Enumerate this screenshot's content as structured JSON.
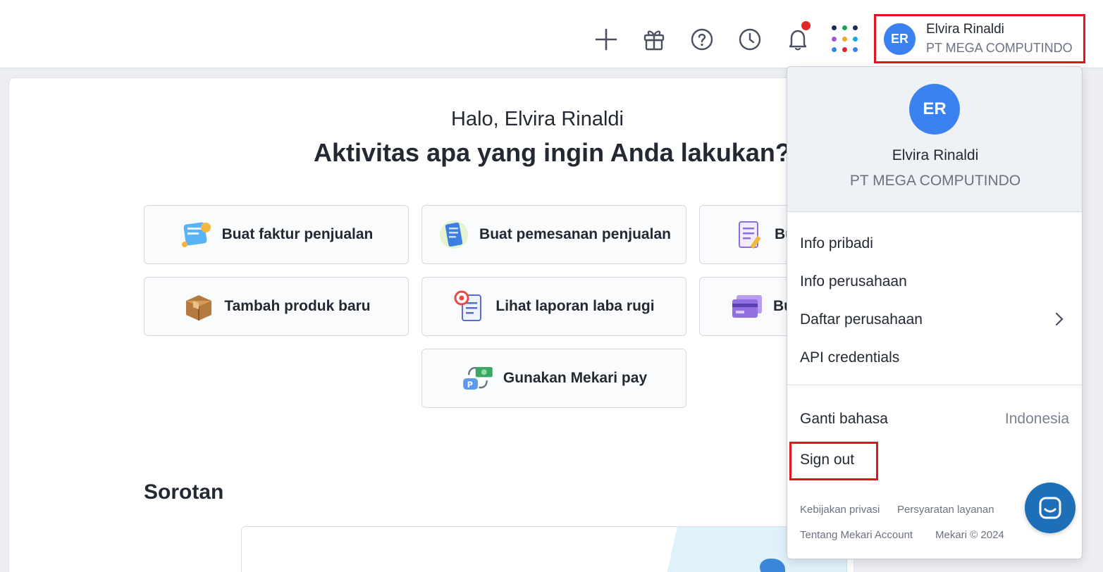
{
  "header": {
    "icons": [
      "plus-icon",
      "gift-icon",
      "help-icon",
      "clock-icon",
      "bell-icon",
      "apps-grid-icon"
    ],
    "notification_dot_color": "#e0262b",
    "user": {
      "initials": "ER",
      "name": "Elvira Rinaldi",
      "company": "PT MEGA COMPUTINDO"
    }
  },
  "main": {
    "greeting": "Halo, Elvira Rinaldi",
    "headline": "Aktivitas apa yang ingin Anda lakukan?",
    "actions": [
      {
        "label": "Buat faktur penjualan",
        "icon": "invoice-scroll-icon"
      },
      {
        "label": "Buat pemesanan penjualan",
        "icon": "order-receipt-icon"
      },
      {
        "label": "Bu",
        "icon": "clipboard-pencil-icon"
      },
      {
        "label": "Tambah produk baru",
        "icon": "box-icon"
      },
      {
        "label": "Lihat laporan laba rugi",
        "icon": "report-target-icon"
      },
      {
        "label": "Bu",
        "icon": "card-icon"
      },
      {
        "label": "Gunakan Mekari pay",
        "icon": "mekari-pay-icon"
      }
    ],
    "section_title": "Sorotan"
  },
  "dropdown": {
    "initials": "ER",
    "name": "Elvira Rinaldi",
    "company": "PT MEGA COMPUTINDO",
    "menu": {
      "personal_info": "Info pribadi",
      "company_info": "Info perusahaan",
      "company_list": "Daftar perusahaan",
      "api_credentials": "API credentials"
    },
    "language_label": "Ganti bahasa",
    "language_value": "Indonesia",
    "sign_out": "Sign out",
    "footer": {
      "privacy": "Kebijakan privasi",
      "terms": "Persyaratan layanan",
      "about": "Tentang Mekari Account",
      "copyright": "Mekari © 2024"
    }
  },
  "colors": {
    "accent": "#3b82f0",
    "highlight": "#e3141f",
    "chat": "#1d6fb8"
  }
}
